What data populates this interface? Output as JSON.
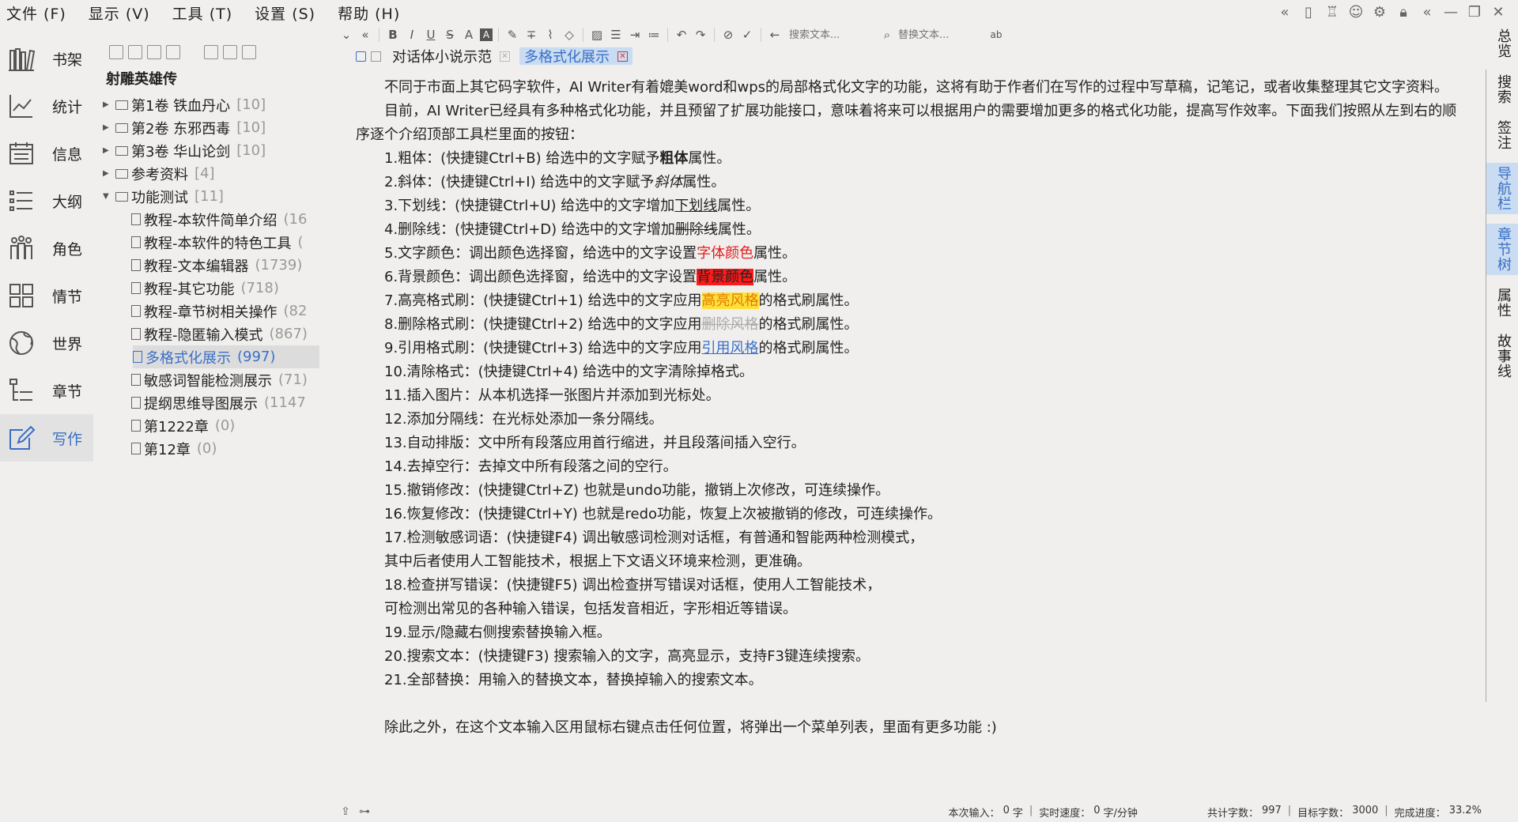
{
  "menubar": {
    "items": [
      "文件 (F)",
      "显示 (V)",
      "工具 (T)",
      "设置 (S)",
      "帮助 (H)"
    ]
  },
  "window_controls": [
    "collapse-icon",
    "phone-icon",
    "shirt-icon",
    "user-icon",
    "settings-icon",
    "lock-icon",
    "back-icon",
    "minimize-icon",
    "restore-icon",
    "close-icon"
  ],
  "leftnav": {
    "items": [
      {
        "label": "书架",
        "icon": "bookshelf-icon"
      },
      {
        "label": "统计",
        "icon": "chart-icon"
      },
      {
        "label": "信息",
        "icon": "calendar-icon"
      },
      {
        "label": "大纲",
        "icon": "list-icon"
      },
      {
        "label": "角色",
        "icon": "people-icon"
      },
      {
        "label": "情节",
        "icon": "grid-icon"
      },
      {
        "label": "世界",
        "icon": "globe-icon"
      },
      {
        "label": "章节",
        "icon": "tree-icon"
      },
      {
        "label": "写作",
        "icon": "pen-icon",
        "active": true
      }
    ]
  },
  "tree": {
    "book_title": "射雕英雄传",
    "nodes": [
      {
        "type": "folder",
        "label": "第1卷 铁血丹心",
        "count": "[10]",
        "expandable": true
      },
      {
        "type": "folder",
        "label": "第2卷 东邪西毒",
        "count": "[10]",
        "expandable": true
      },
      {
        "type": "folder",
        "label": "第3卷 华山论剑",
        "count": "[10]",
        "expandable": true
      },
      {
        "type": "folder",
        "label": "参考资料",
        "count": "[4]",
        "expandable": true
      },
      {
        "type": "folder",
        "label": "功能测试",
        "count": "[11]",
        "expanded": true
      },
      {
        "type": "doc",
        "label": "教程-本软件简单介绍",
        "count": "(16"
      },
      {
        "type": "doc",
        "label": "教程-本软件的特色工具",
        "count": "("
      },
      {
        "type": "doc",
        "label": "教程-文本编辑器",
        "count": "(1739)"
      },
      {
        "type": "doc",
        "label": "教程-其它功能",
        "count": "(718)"
      },
      {
        "type": "doc",
        "label": "教程-章节树相关操作",
        "count": "(82"
      },
      {
        "type": "doc",
        "label": "教程-隐匿输入模式",
        "count": "(867)"
      },
      {
        "type": "doc",
        "label": "多格式化展示",
        "count": "(997)",
        "selected": true
      },
      {
        "type": "doc",
        "label": "敏感词智能检测展示",
        "count": "(71)"
      },
      {
        "type": "doc",
        "label": "提纲思维导图展示",
        "count": "(1147"
      },
      {
        "type": "doc",
        "label": "第1222章",
        "count": "(0)"
      },
      {
        "type": "doc",
        "label": "第12章",
        "count": "(0)"
      }
    ]
  },
  "toolbar": {
    "search_placeholder": "搜索文本...",
    "replace_placeholder": "替换文本..."
  },
  "tabs": [
    {
      "label": "对话体小说示范",
      "active": false
    },
    {
      "label": "多格式化展示",
      "active": true
    }
  ],
  "editor": {
    "p1": "不同于市面上其它码字软件，AI Writer有着媲美word和wps的局部格式化文字的功能，这将有助于作者们在写作的过程中写草稿，记笔记，或者收集整理其它文字资料。",
    "p2": "目前，AI Writer已经具有多种格式化功能，并且预留了扩展功能接口，意味着将来可以根据用户的需要增加更多的格式化功能，提高写作效率。下面我们按照从左到右的顺序逐个介绍顶部工具栏里面的按钮：",
    "l1a": "1.粗体：(快捷键Ctrl+B) 给选中的文字赋予",
    "l1b": "粗体",
    "l1c": "属性。",
    "l2a": "2.斜体：(快捷键Ctrl+I) 给选中的文字赋予",
    "l2b": "斜体",
    "l2c": "属性。",
    "l3a": "3.下划线：(快捷键Ctrl+U) 给选中的文字增加",
    "l3b": "下划线",
    "l3c": "属性。",
    "l4a": "4.删除线：(快捷键Ctrl+D) 给选中的文字增加",
    "l4b": "删除线",
    "l4c": "属性。",
    "l5a": "5.文字颜色：调出颜色选择窗，给选中的文字设置",
    "l5b": "字体颜色",
    "l5c": "属性。",
    "l6a": "6.背景颜色：调出颜色选择窗，给选中的文字设置",
    "l6b": "背景颜色",
    "l6c": "属性。",
    "l7a": "7.高亮格式刷：(快捷键Ctrl+1) 给选中的文字应用",
    "l7b": "高亮风格",
    "l7c": "的格式刷属性。",
    "l8a": "8.删除格式刷：(快捷键Ctrl+2) 给选中的文字应用",
    "l8b": "删除风格",
    "l8c": "的格式刷属性。",
    "l9a": "9.引用格式刷：(快捷键Ctrl+3) 给选中的文字应用",
    "l9b": "引用风格",
    "l9c": "的格式刷属性。",
    "l10": "10.清除格式：(快捷键Ctrl+4) 给选中的文字清除掉格式。",
    "l11": "11.插入图片：从本机选择一张图片并添加到光标处。",
    "l12": "12.添加分隔线：在光标处添加一条分隔线。",
    "l13": "13.自动排版：文中所有段落应用首行缩进，并且段落间插入空行。",
    "l14": "14.去掉空行：去掉文中所有段落之间的空行。",
    "l15": "15.撤销修改：(快捷键Ctrl+Z) 也就是undo功能，撤销上次修改，可连续操作。",
    "l16": "16.恢复修改：(快捷键Ctrl+Y) 也就是redo功能，恢复上次被撤销的修改，可连续操作。",
    "l17a": "17.检测敏感词语：(快捷键F4) 调出敏感词检测对话框，有普通和智能两种检测模式，",
    "l17b": "其中后者使用人工智能技术，根据上下文语义环境来检测，更准确。",
    "l18a": "18.检查拼写错误：(快捷键F5) 调出检查拼写错误对话框，使用人工智能技术，",
    "l18b": "可检测出常见的各种输入错误，包括发音相近，字形相近等错误。",
    "l19": "19.显示/隐藏右侧搜索替换输入框。",
    "l20": "20.搜索文本：(快捷键F3) 搜索输入的文字，高亮显示，支持F3键连续搜索。",
    "l21": "21.全部替换：用输入的替换文本，替换掉输入的搜索文本。",
    "p3": "除此之外，在这个文本输入区用鼠标右键点击任何位置，将弹出一个菜单列表，里面有更多功能 :)"
  },
  "rightbar": {
    "tabs": [
      {
        "label": "总览",
        "active": false
      },
      {
        "label": "搜索",
        "active": false
      },
      {
        "label": "签注",
        "active": false
      },
      {
        "label": "导航栏",
        "active": true
      },
      {
        "label": "章节树",
        "active": true
      },
      {
        "label": "属性",
        "active": false
      },
      {
        "label": "故事线",
        "active": false
      }
    ]
  },
  "status": {
    "input_label": "本次输入：",
    "input_value": "0",
    "input_unit": "字",
    "speed_label": "实时速度：",
    "speed_value": "0",
    "speed_unit": "字/分钟",
    "total_label": "共计字数：",
    "total_value": "997",
    "target_label": "目标字数：",
    "target_value": "3000",
    "progress_label": "完成进度：",
    "progress_value": "33.2%"
  }
}
